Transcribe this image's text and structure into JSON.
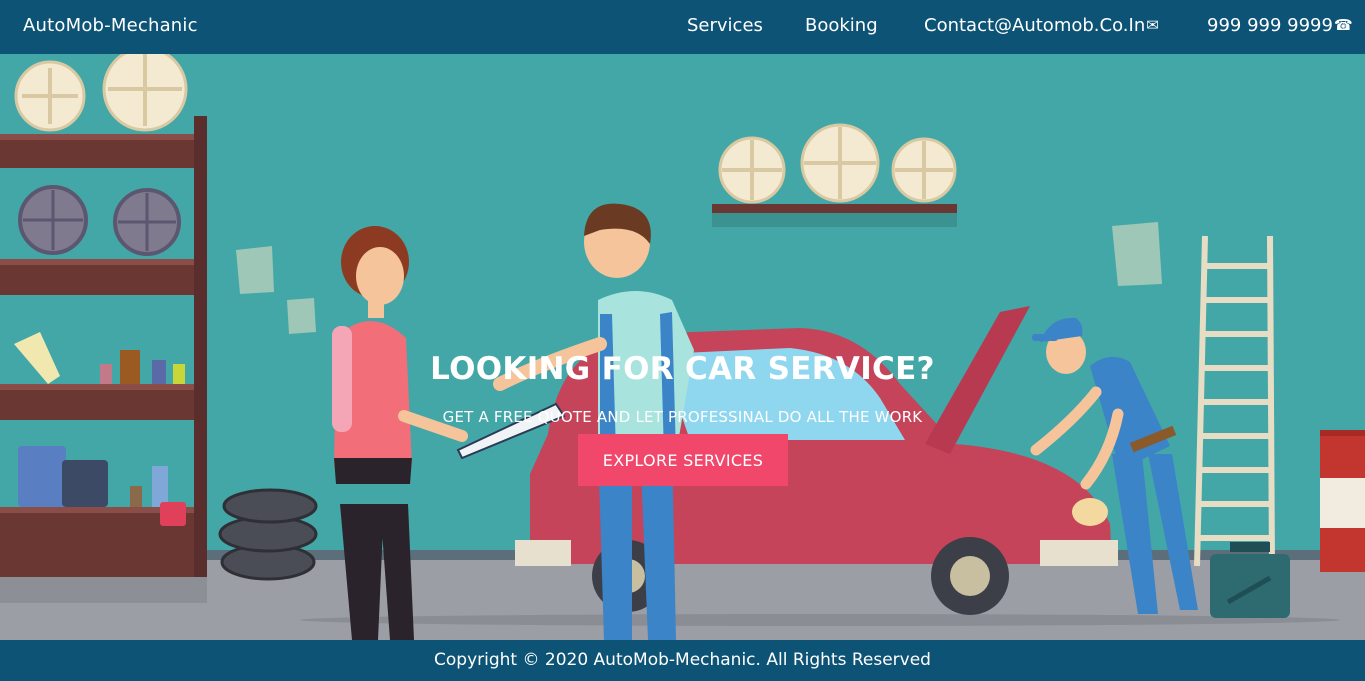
{
  "nav": {
    "brand": "AutoMob-Mechanic",
    "links": [
      {
        "label": "Services"
      },
      {
        "label": "Booking"
      },
      {
        "label": "Contact@Automob.Co.In",
        "icon": "mail-icon"
      },
      {
        "label": "999 999 9999",
        "icon": "phone-icon"
      }
    ]
  },
  "hero": {
    "title": "LOOKING FOR CAR SERVICE?",
    "subtitle": "GET A FREE QUOTE AND LET PROFESSINAL DO ALL THE WORK",
    "cta_label": "EXPLORE SERVICES"
  },
  "footer": {
    "copyright": "Copyright © 2020 AutoMob-Mechanic. All Rights Reserved"
  },
  "colors": {
    "nav_bg": "#0d5375",
    "wall": "#42a7a6",
    "floor": "#9b9ea4",
    "cta": "#f0476b",
    "car": "#c5445a"
  }
}
